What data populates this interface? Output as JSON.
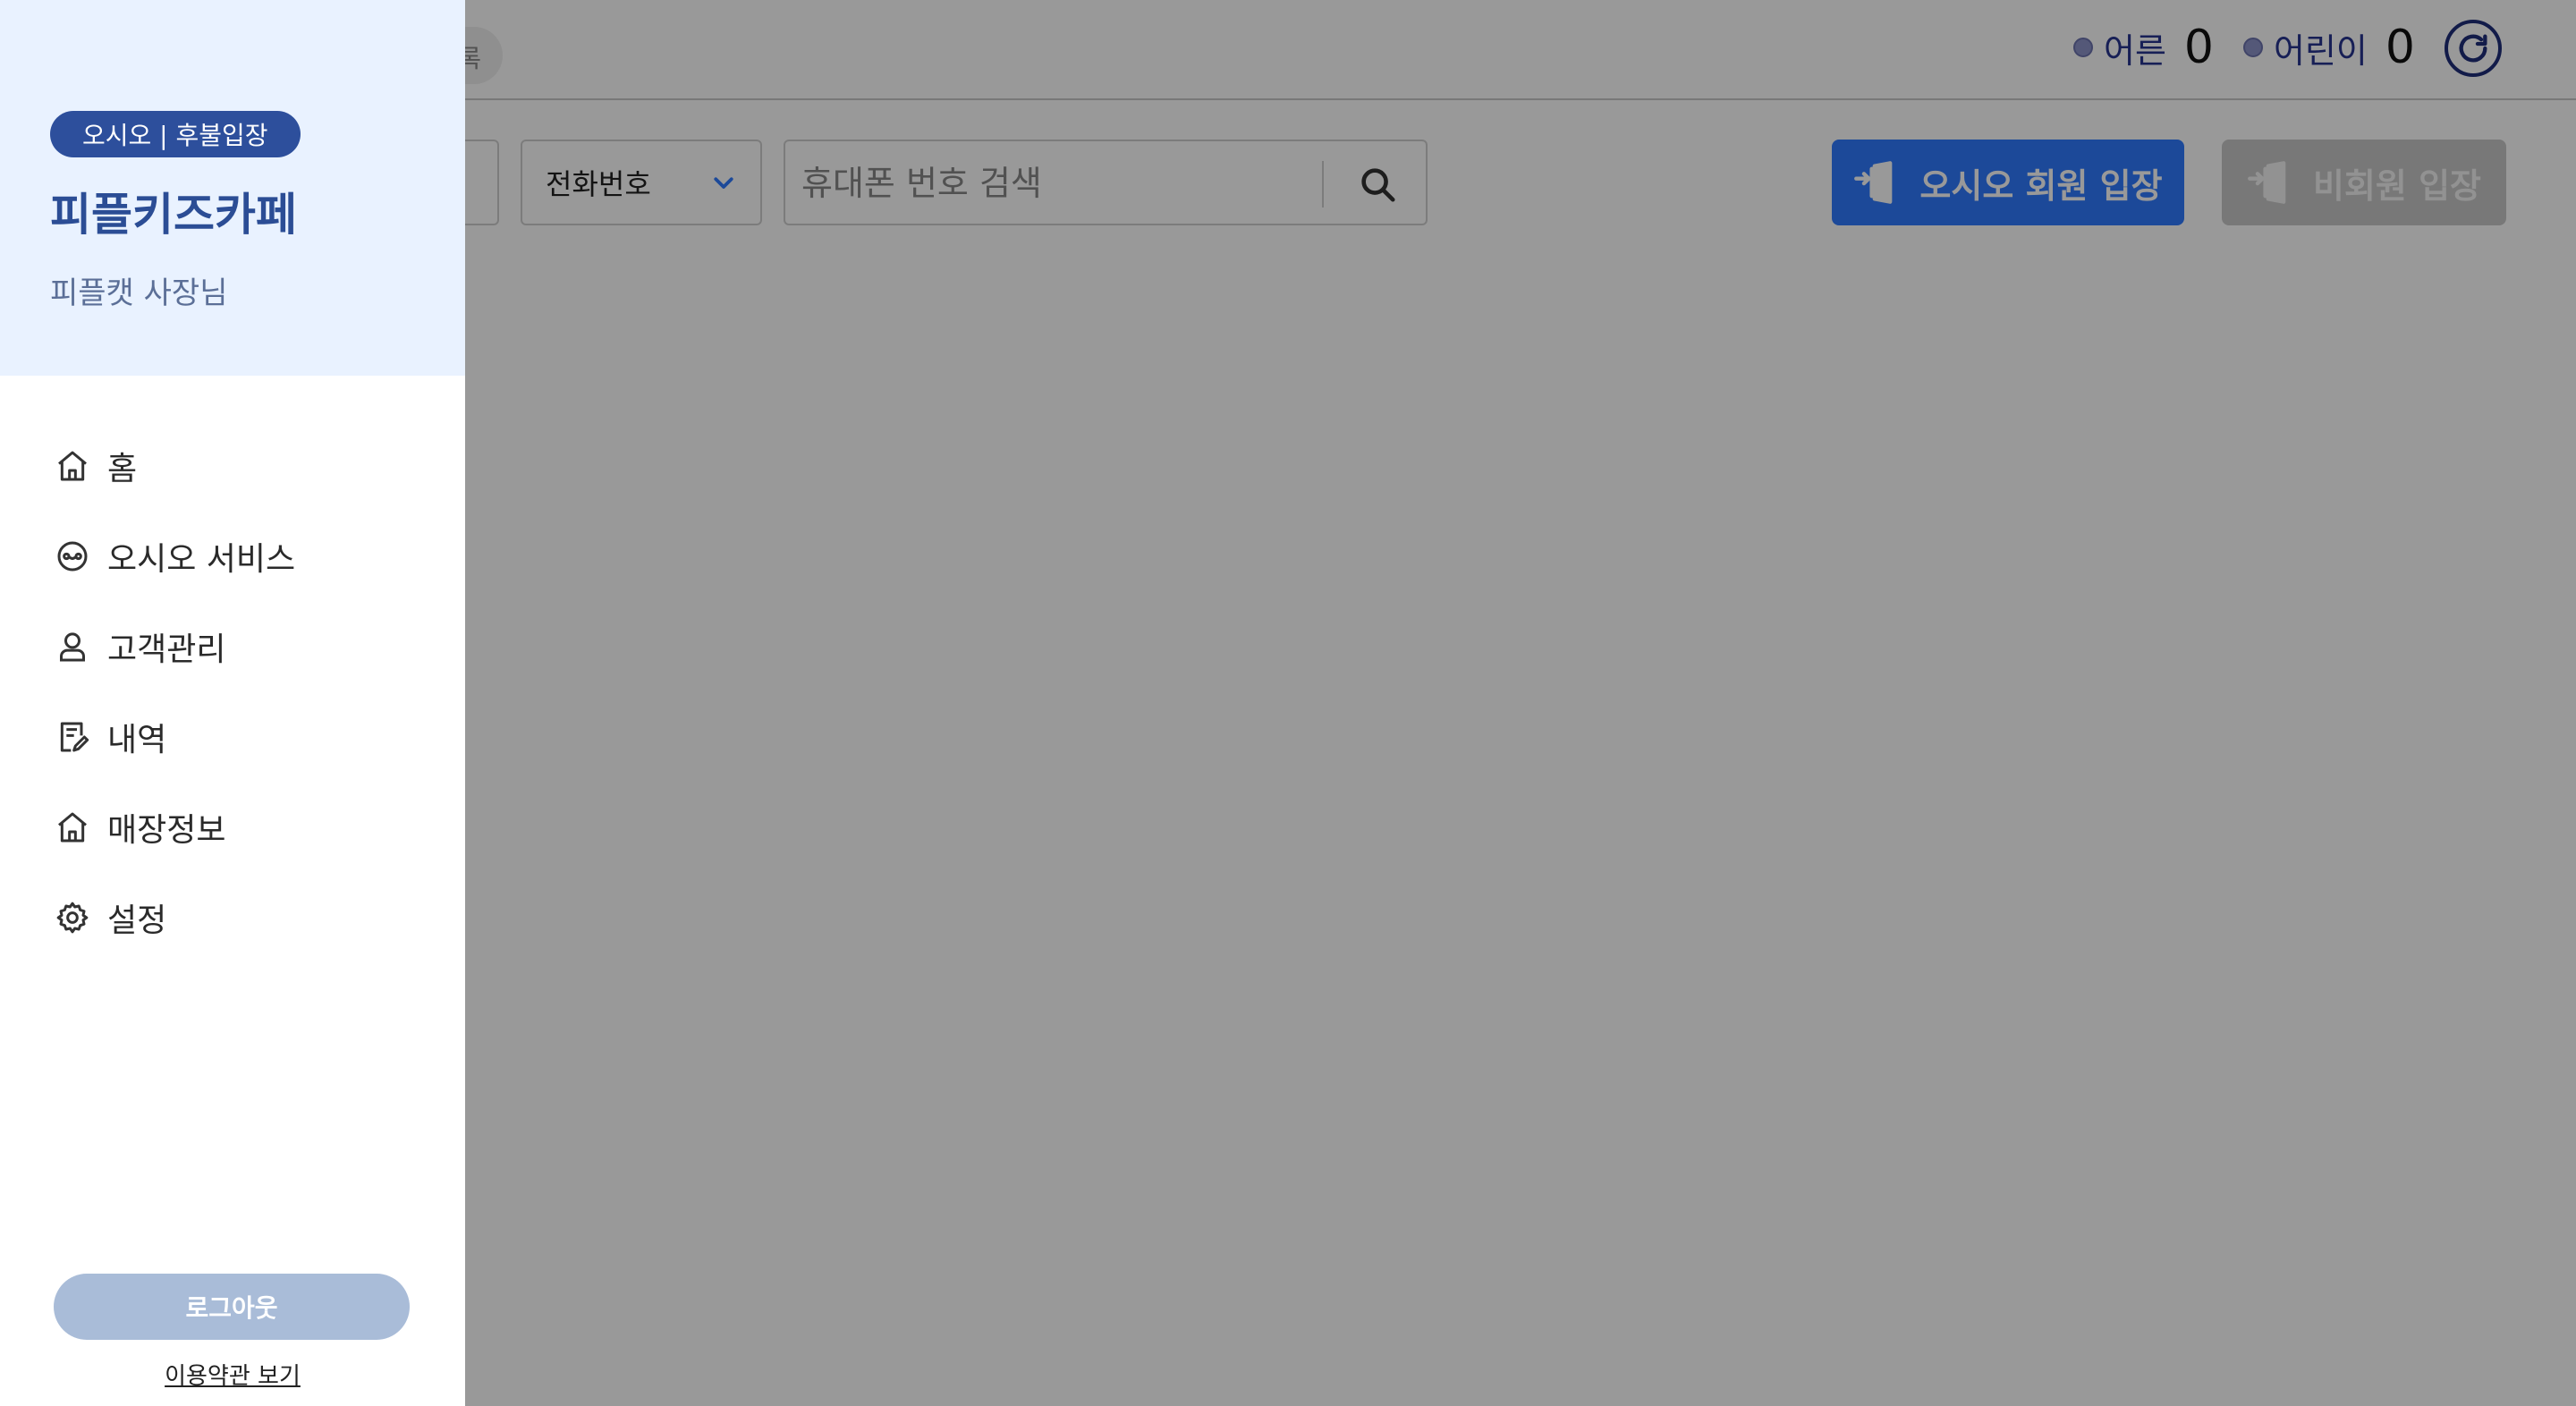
{
  "topbar": {
    "partial_chip": "록",
    "counters": [
      {
        "label": "어른",
        "value": "0"
      },
      {
        "label": "어린이",
        "value": "0"
      }
    ],
    "refresh_icon": "refresh-icon"
  },
  "toolbar": {
    "select_value": "전화번호",
    "search_placeholder": "휴대폰 번호 검색",
    "member_button": "오시오 회원 입장",
    "guest_button": "비회원 입장"
  },
  "drawer": {
    "badge": "오시오 | 후불입장",
    "store_name": "피플키즈카페",
    "owner": "피플캣 사장님",
    "menu": [
      {
        "label": "홈",
        "icon": "home-icon"
      },
      {
        "label": "오시오 서비스",
        "icon": "service-icon"
      },
      {
        "label": "고객관리",
        "icon": "user-icon"
      },
      {
        "label": "내역",
        "icon": "history-icon"
      },
      {
        "label": "매장정보",
        "icon": "store-icon"
      },
      {
        "label": "설정",
        "icon": "gear-icon"
      }
    ],
    "logout": "로그아웃",
    "terms": "이용약관 보기"
  },
  "colors": {
    "primary": "#2f7bff",
    "drawer_header_bg": "#e9f2ff",
    "badge_bg": "#2d4f9c",
    "store_name": "#2b4d95",
    "logout_bg": "#a9bcd8"
  }
}
